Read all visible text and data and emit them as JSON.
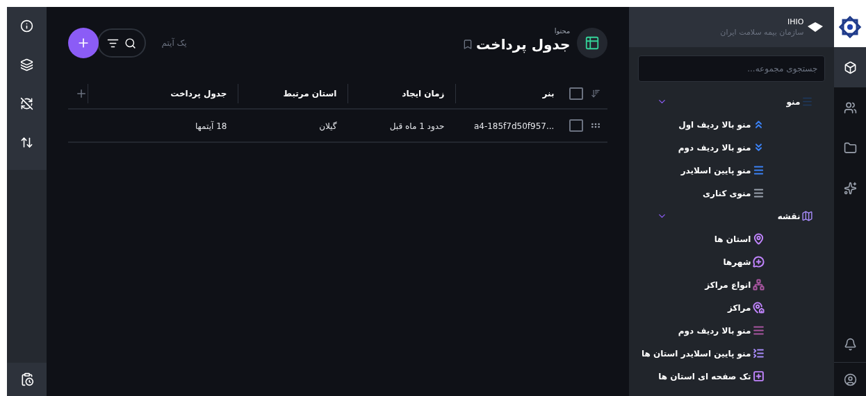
{
  "left_toolbar": {
    "buttons": [
      {
        "selected": false
      },
      {
        "selected": false
      },
      {
        "selected": false
      },
      {
        "selected": false
      }
    ]
  },
  "header": {
    "breadcrumb": "محتوا",
    "title": "جدول پرداخت",
    "item_count": "یک آیتم",
    "bookmarked": false
  },
  "table": {
    "all_selected": false,
    "columns": [
      "بنر",
      "زمان ایجاد",
      "استان مرتبط",
      "جدول پرداخت"
    ],
    "rows": [
      {
        "selected": false,
        "cells": [
          "a4-185f7d50f957...",
          "حدود 1 ماه قبل",
          "گیلان",
          "18 آیتمها"
        ]
      }
    ]
  },
  "project": {
    "name": "IHIO",
    "subtitle": "سازمان بیمه سلامت ایران"
  },
  "search": {
    "placeholder": "جستجوی مجموعه..."
  },
  "tree": [
    {
      "label": "منو",
      "expanded": true,
      "color": "#1e3a5f",
      "children": [
        {
          "label": "منو بالا ردیف اول",
          "color": "#3b82f6"
        },
        {
          "label": "منو بالا ردیف دوم",
          "color": "#3b82f6"
        },
        {
          "label": "منو پایین اسلایدر",
          "color": "#3b82f6"
        },
        {
          "label": "منوی کناری",
          "color": "#9ca3af"
        }
      ]
    },
    {
      "label": "نقشه",
      "expanded": true,
      "color": "#a78bfa",
      "children": [
        {
          "label": "استان ها",
          "color": "#c084fc"
        },
        {
          "label": "شهرها",
          "color": "#c084fc"
        },
        {
          "label": "انواع مراکز",
          "color": "#a855a0"
        },
        {
          "label": "مراکز",
          "color": "#c084fc"
        },
        {
          "label": "منو بالا ردیف دوم",
          "color": "#a855a0"
        },
        {
          "label": "منو پایین اسلایدر استان ها",
          "color": "#a78bfa"
        },
        {
          "label": "تک صفحه ای استان ها",
          "color": "#c084fc"
        }
      ]
    }
  ],
  "module_bar": [
    {
      "selected": true
    },
    {
      "selected": false
    },
    {
      "selected": false
    },
    {
      "selected": false
    }
  ]
}
